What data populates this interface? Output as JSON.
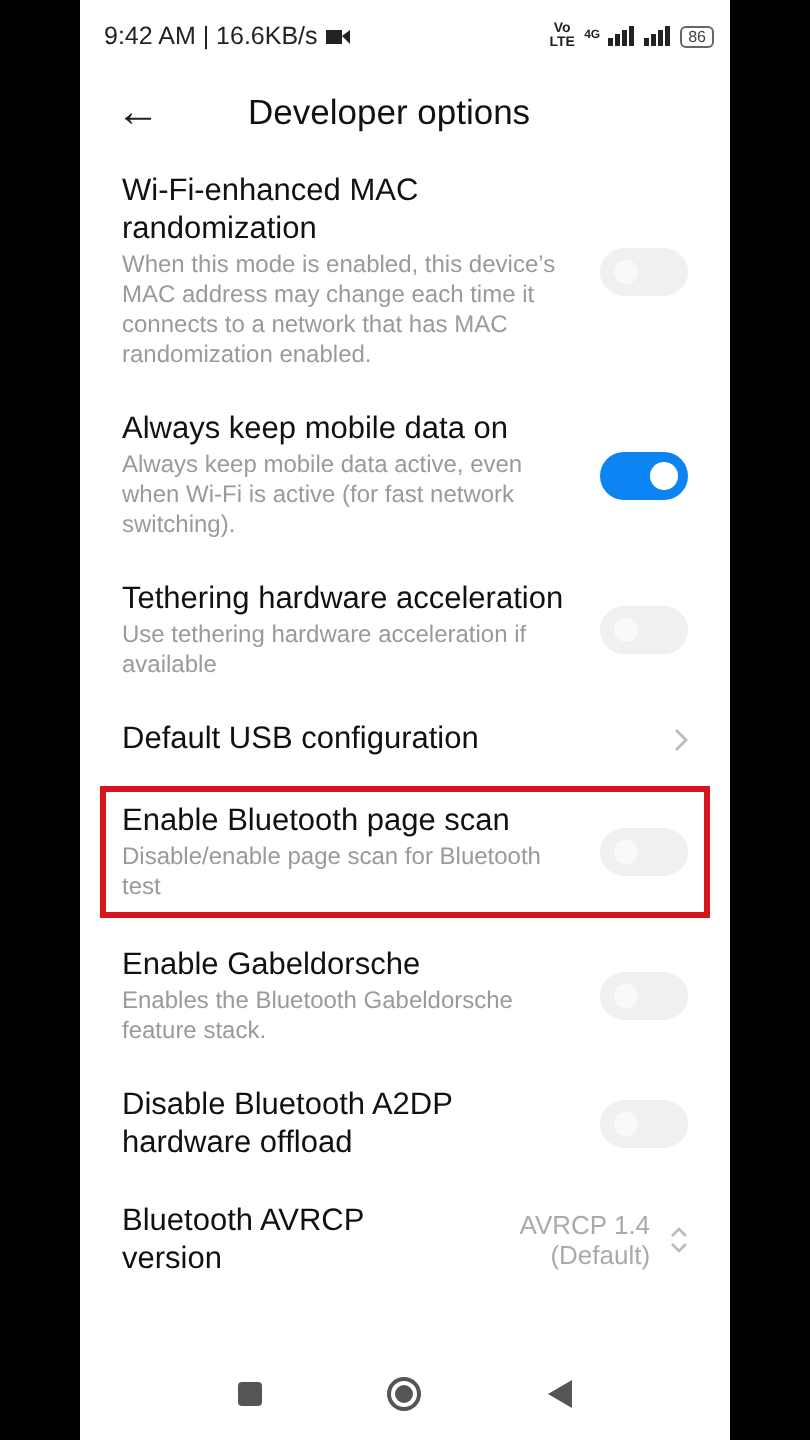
{
  "status_bar": {
    "time": "9:42 AM | 16.6KB/s",
    "network_label": "Vo LTE",
    "network_type": "4G",
    "battery": "86"
  },
  "header": {
    "back": "←",
    "title": "Developer options"
  },
  "settings": [
    {
      "kind": "toggle",
      "title": "Wi-Fi-enhanced MAC randomization",
      "description": "When this mode is enabled, this device’s MAC address may change each time it connects to a network that has MAC randomization enabled.",
      "on": false,
      "highlighted": false
    },
    {
      "kind": "toggle",
      "title": "Always keep mobile data on",
      "description": "Always keep mobile data active, even when Wi-Fi is active (for fast network switching).",
      "on": true,
      "highlighted": false
    },
    {
      "kind": "toggle",
      "title": "Tethering hardware acceleration",
      "description": "Use tethering hardware acceleration if available",
      "on": false,
      "highlighted": false
    },
    {
      "kind": "link",
      "title": "Default USB configuration",
      "highlighted": false
    },
    {
      "kind": "toggle",
      "title": "Enable Bluetooth page scan",
      "description": "Disable/enable page scan for Bluetooth test",
      "on": false,
      "highlighted": true
    },
    {
      "kind": "toggle",
      "title": "Enable Gabeldorsche",
      "description": "Enables the Bluetooth Gabeldorsche feature stack.",
      "on": false,
      "highlighted": false
    },
    {
      "kind": "toggle",
      "title": "Disable Bluetooth A2DP hardware offload",
      "on": false,
      "highlighted": false
    },
    {
      "kind": "select",
      "title": "Bluetooth AVRCP version",
      "value": "AVRCP 1.4 (Default)",
      "highlighted": false
    }
  ]
}
